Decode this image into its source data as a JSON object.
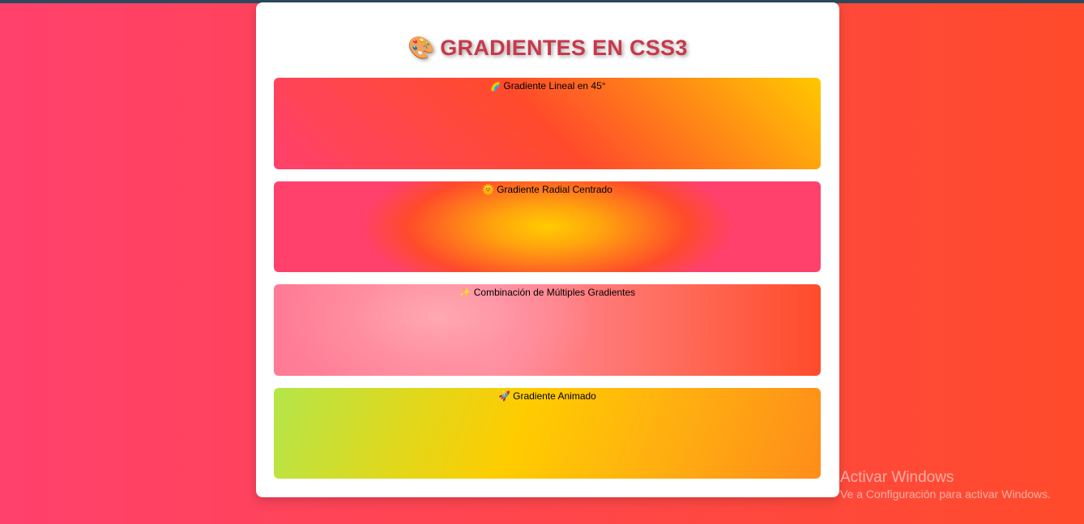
{
  "page": {
    "title_emoji": "🎨",
    "title": "GRADIENTES EN CSS3"
  },
  "gradients": [
    {
      "icon": "🌈",
      "label": "Gradiente Lineal en 45°"
    },
    {
      "icon": "🌞",
      "label": "Gradiente Radial Centrado"
    },
    {
      "icon": "✨",
      "label": "Combinación de Múltiples Gradientes"
    },
    {
      "icon": "🚀",
      "label": "Gradiente Animado"
    }
  ],
  "watermark": {
    "title": "Activar Windows",
    "subtitle": "Ve a Configuración para activar Windows."
  },
  "colors": {
    "background_start": "#ff416c",
    "background_end": "#ff4b2b",
    "title_color": "#c8384a",
    "card": "#ffffff"
  }
}
